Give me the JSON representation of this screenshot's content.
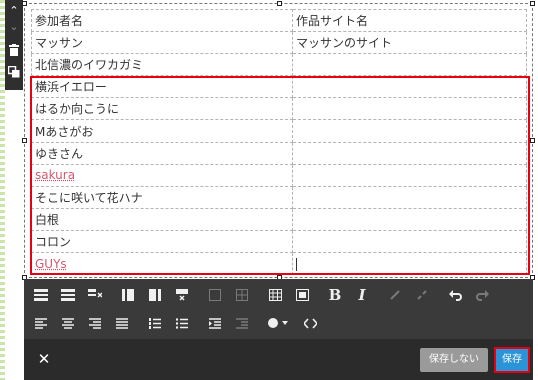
{
  "rail": {
    "up_icon": "⌃",
    "down_icon": "⌄",
    "delete_icon": "trash-icon",
    "copy_icon": "copy-icon"
  },
  "table": {
    "rows": [
      [
        "参加者名",
        "作品サイト名"
      ],
      [
        "マッサン",
        "マッサンのサイト"
      ],
      [
        "北信濃のイワカガミ",
        ""
      ],
      [
        "横浜イエロー",
        ""
      ],
      [
        "はるか向こうに",
        ""
      ],
      [
        "Mあさがお",
        ""
      ],
      [
        "ゆきさん",
        ""
      ],
      [
        "sakura",
        ""
      ],
      [
        "そこに咲いて花ハナ",
        ""
      ],
      [
        "白根",
        ""
      ],
      [
        "コロン",
        ""
      ],
      [
        "GUYs",
        ""
      ]
    ],
    "spell_rows": [
      7,
      11
    ]
  },
  "toolbar": {
    "bold_label": "B",
    "italic_label": "I"
  },
  "footer": {
    "close_label": "✕",
    "nosave_label": "保存しない",
    "save_label": "保存"
  },
  "colors": {
    "highlight": "#e60012",
    "save_button": "#2b93d8",
    "toolbar_bg": "#3a3a3a"
  }
}
